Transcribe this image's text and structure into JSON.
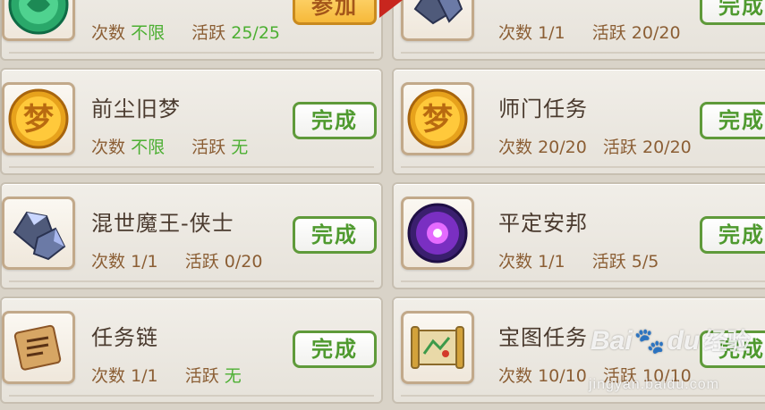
{
  "labels": {
    "times": "次数",
    "activity": "活跃"
  },
  "activities": [
    {
      "name": "",
      "times": "不限",
      "activity": "25/25",
      "button": "参加",
      "button_style": "orange",
      "icon": "green-jade-token-icon"
    },
    {
      "name": "",
      "times": "1/1",
      "activity": "20/20",
      "button": "完成",
      "button_style": "green",
      "icon": "crystal-ore-icon"
    },
    {
      "name": "前尘旧梦",
      "times": "不限",
      "activity": "无",
      "button": "完成",
      "button_style": "green",
      "icon": "gold-dream-coin-icon"
    },
    {
      "name": "师门任务",
      "times": "20/20",
      "activity": "20/20",
      "button": "完成",
      "button_style": "green",
      "icon": "gold-dream-coin-icon"
    },
    {
      "name": "混世魔王-侠士",
      "times": "1/1",
      "activity": "0/20",
      "button": "完成",
      "button_style": "green",
      "icon": "crystal-ore-icon"
    },
    {
      "name": "平定安邦",
      "times": "1/1",
      "activity": "5/5",
      "button": "完成",
      "button_style": "green",
      "icon": "purple-orb-icon"
    },
    {
      "name": "任务链",
      "times": "1/1",
      "activity": "无",
      "button": "完成",
      "button_style": "green",
      "icon": "ancient-scroll-icon"
    },
    {
      "name": "宝图任务",
      "times": "10/10",
      "activity": "10/10",
      "button": "完成",
      "button_style": "green",
      "icon": "treasure-map-icon"
    }
  ],
  "watermark": {
    "brand": "Bai",
    "brand_end": "du",
    "cn": "经验",
    "url": "jingyan.baidu.com"
  }
}
